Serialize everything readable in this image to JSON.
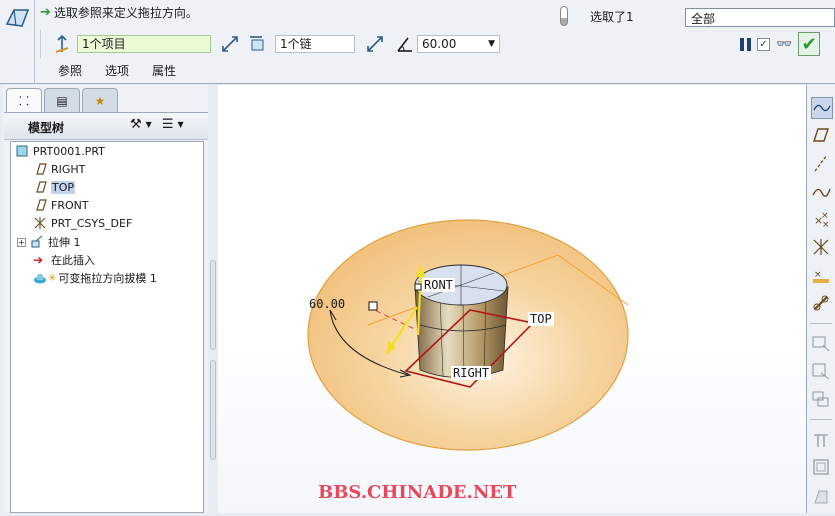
{
  "dashboard": {
    "message": "选取参照来定义拖拉方向。",
    "status": "选取了1",
    "filter": "全部",
    "collector_items": "1个项目",
    "collector_chain": "1个链",
    "angle": "60.00",
    "tabs": [
      "参照",
      "选项",
      "属性"
    ]
  },
  "panel": {
    "title": "模型树"
  },
  "tree": {
    "items": [
      {
        "label": "PRT0001.PRT"
      },
      {
        "label": "RIGHT"
      },
      {
        "label": "TOP"
      },
      {
        "label": "FRONT"
      },
      {
        "label": "PRT_CSYS_DEF"
      },
      {
        "label": "拉伸 1"
      },
      {
        "label": "在此插入"
      },
      {
        "label": "可变拖拉方向拔模 1"
      }
    ]
  },
  "viewport": {
    "angle_label": "60.00",
    "front_label": "RONT",
    "top_label": "TOP",
    "right_label": "RIGHT",
    "watermark": "BBS.CHINADE.NET"
  },
  "colors": {
    "accent_green": "#2e9a2e",
    "disc": "#f5c98a",
    "datum_red": "#b01818",
    "watermark": "#e8495a"
  }
}
